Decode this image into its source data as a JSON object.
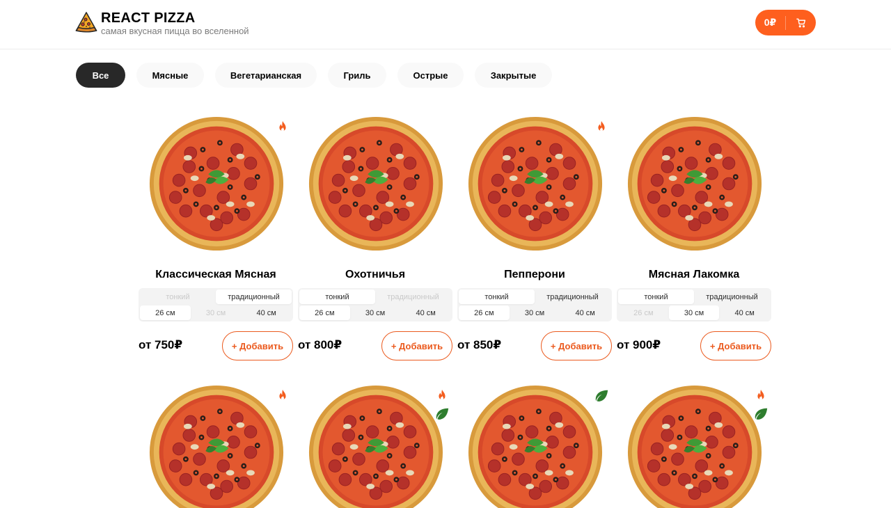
{
  "header": {
    "title": "REACT PIZZA",
    "subtitle": "самая вкусная пицца во вселенной",
    "cart": {
      "total": "0₽",
      "icon": "cart-icon"
    }
  },
  "categories": [
    "Все",
    "Мясные",
    "Вегетарианская",
    "Гриль",
    "Острые",
    "Закрытые"
  ],
  "active_category": "Все",
  "doughs": [
    "тонкий",
    "традиционный"
  ],
  "sizes": [
    "26 см",
    "30 см",
    "40 см"
  ],
  "add_label": "+ Добавить",
  "colors": {
    "accent": "#fe5f1e",
    "spicy": "#f35d1f",
    "vegetarian": "#2e7d2e",
    "active_category": "#282828"
  },
  "pizzas": [
    {
      "title": "Классическая Мясная",
      "price": "от 750₽",
      "badges": [
        "spicy"
      ],
      "dough_active": 1,
      "dough_disabled": [
        0
      ],
      "size_active": 0,
      "size_disabled": [
        1
      ]
    },
    {
      "title": "Охотничья",
      "price": "от 800₽",
      "badges": [],
      "dough_active": 0,
      "dough_disabled": [
        1
      ],
      "size_active": 0,
      "size_disabled": []
    },
    {
      "title": "Пепперони",
      "price": "от 850₽",
      "badges": [
        "spicy"
      ],
      "dough_active": 0,
      "dough_disabled": [],
      "size_active": 0,
      "size_disabled": []
    },
    {
      "title": "Мясная Лакомка",
      "price": "от 900₽",
      "badges": [],
      "dough_active": 0,
      "dough_disabled": [],
      "size_active": 1,
      "size_disabled": [
        0
      ]
    },
    {
      "title": "",
      "price": "",
      "badges": [
        "spicy"
      ]
    },
    {
      "title": "",
      "price": "",
      "badges": [
        "spicy",
        "vegetarian"
      ]
    },
    {
      "title": "",
      "price": "",
      "badges": [
        "vegetarian"
      ]
    },
    {
      "title": "",
      "price": "",
      "badges": [
        "spicy",
        "vegetarian"
      ]
    }
  ]
}
